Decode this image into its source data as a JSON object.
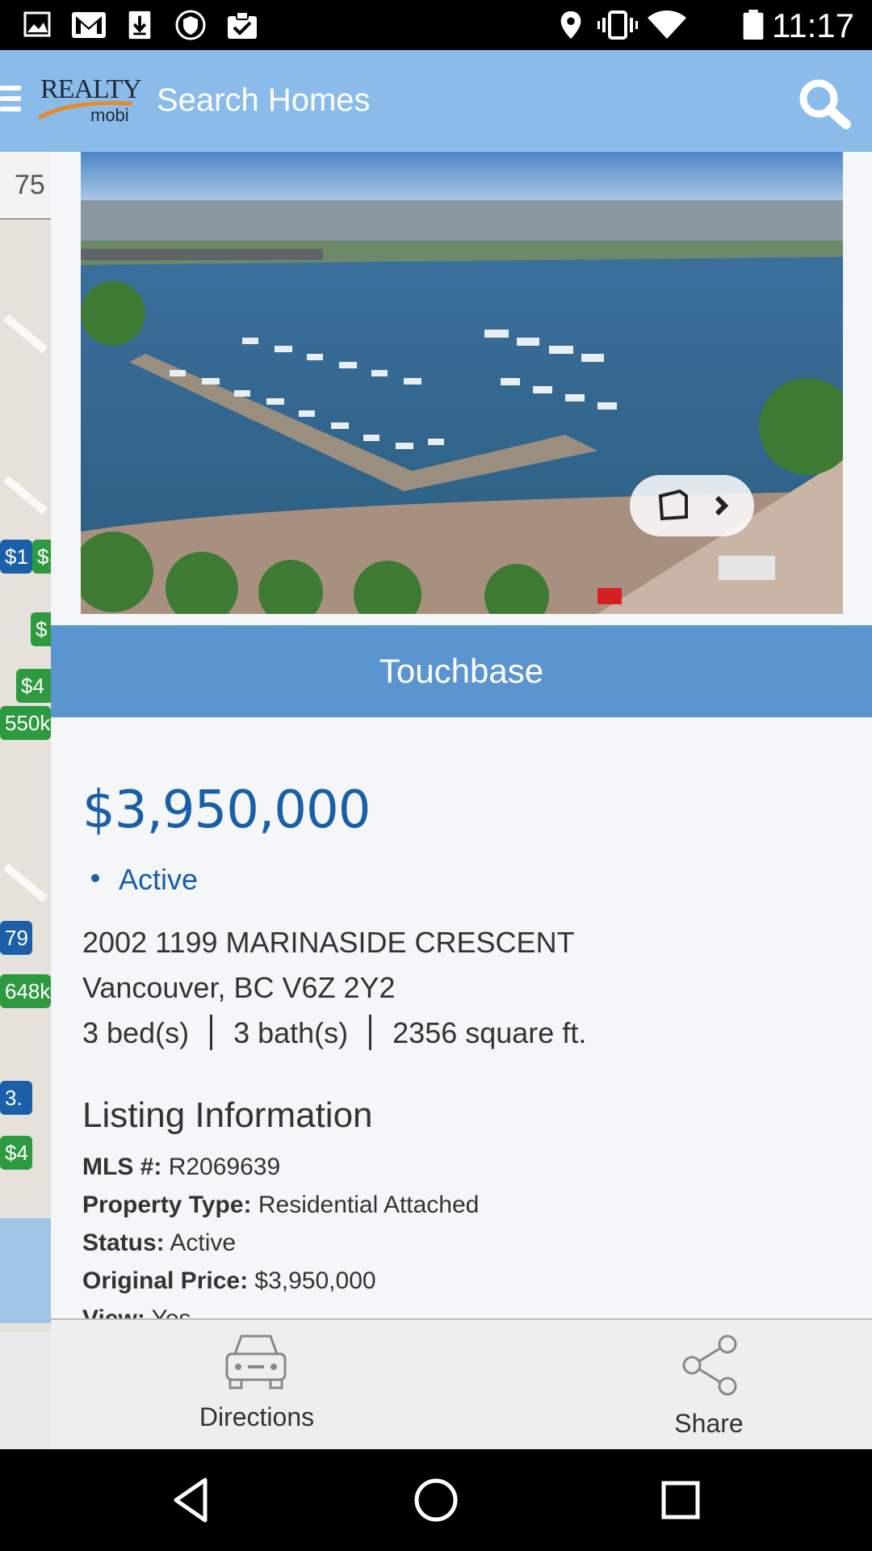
{
  "status_bar": {
    "time": "11:17",
    "left_icons": [
      "image-icon",
      "gmail-icon",
      "download-icon",
      "shield-icon",
      "clipboard-check-icon"
    ],
    "right_icons": [
      "location-icon",
      "vibrate-icon",
      "wifi-icon",
      "battery-icon"
    ]
  },
  "app_bar": {
    "logo_text": "REALTY",
    "logo_sub": "mobi",
    "title": "Search Homes"
  },
  "map": {
    "top_label": "75",
    "pins": [
      "$1",
      "$",
      "$",
      "$4",
      "550k",
      "79",
      "648k",
      "3.",
      "$4"
    ]
  },
  "listing": {
    "brokerage": "Touchbase",
    "price": "$3,950,000",
    "status": "Active",
    "address_line1": "2002 1199 MARINASIDE CRESCENT",
    "address_line2": "Vancouver, BC V6Z 2Y2",
    "beds": "3 bed(s)",
    "baths": "3 bath(s)",
    "area": "2356 square ft.",
    "section_title": "Listing Information",
    "info": [
      {
        "label": "MLS #:",
        "value": "R2069639"
      },
      {
        "label": "Property Type:",
        "value": "Residential Attached"
      },
      {
        "label": "Status:",
        "value": "Active"
      },
      {
        "label": "Original Price:",
        "value": "$3,950,000"
      },
      {
        "label": "View:",
        "value": "Yes"
      }
    ]
  },
  "actions": {
    "directions": "Directions",
    "share": "Share"
  },
  "colors": {
    "app_bar": "#8bbce9",
    "brokerage_banner": "#5b95d0",
    "price": "#1a5ea8"
  }
}
